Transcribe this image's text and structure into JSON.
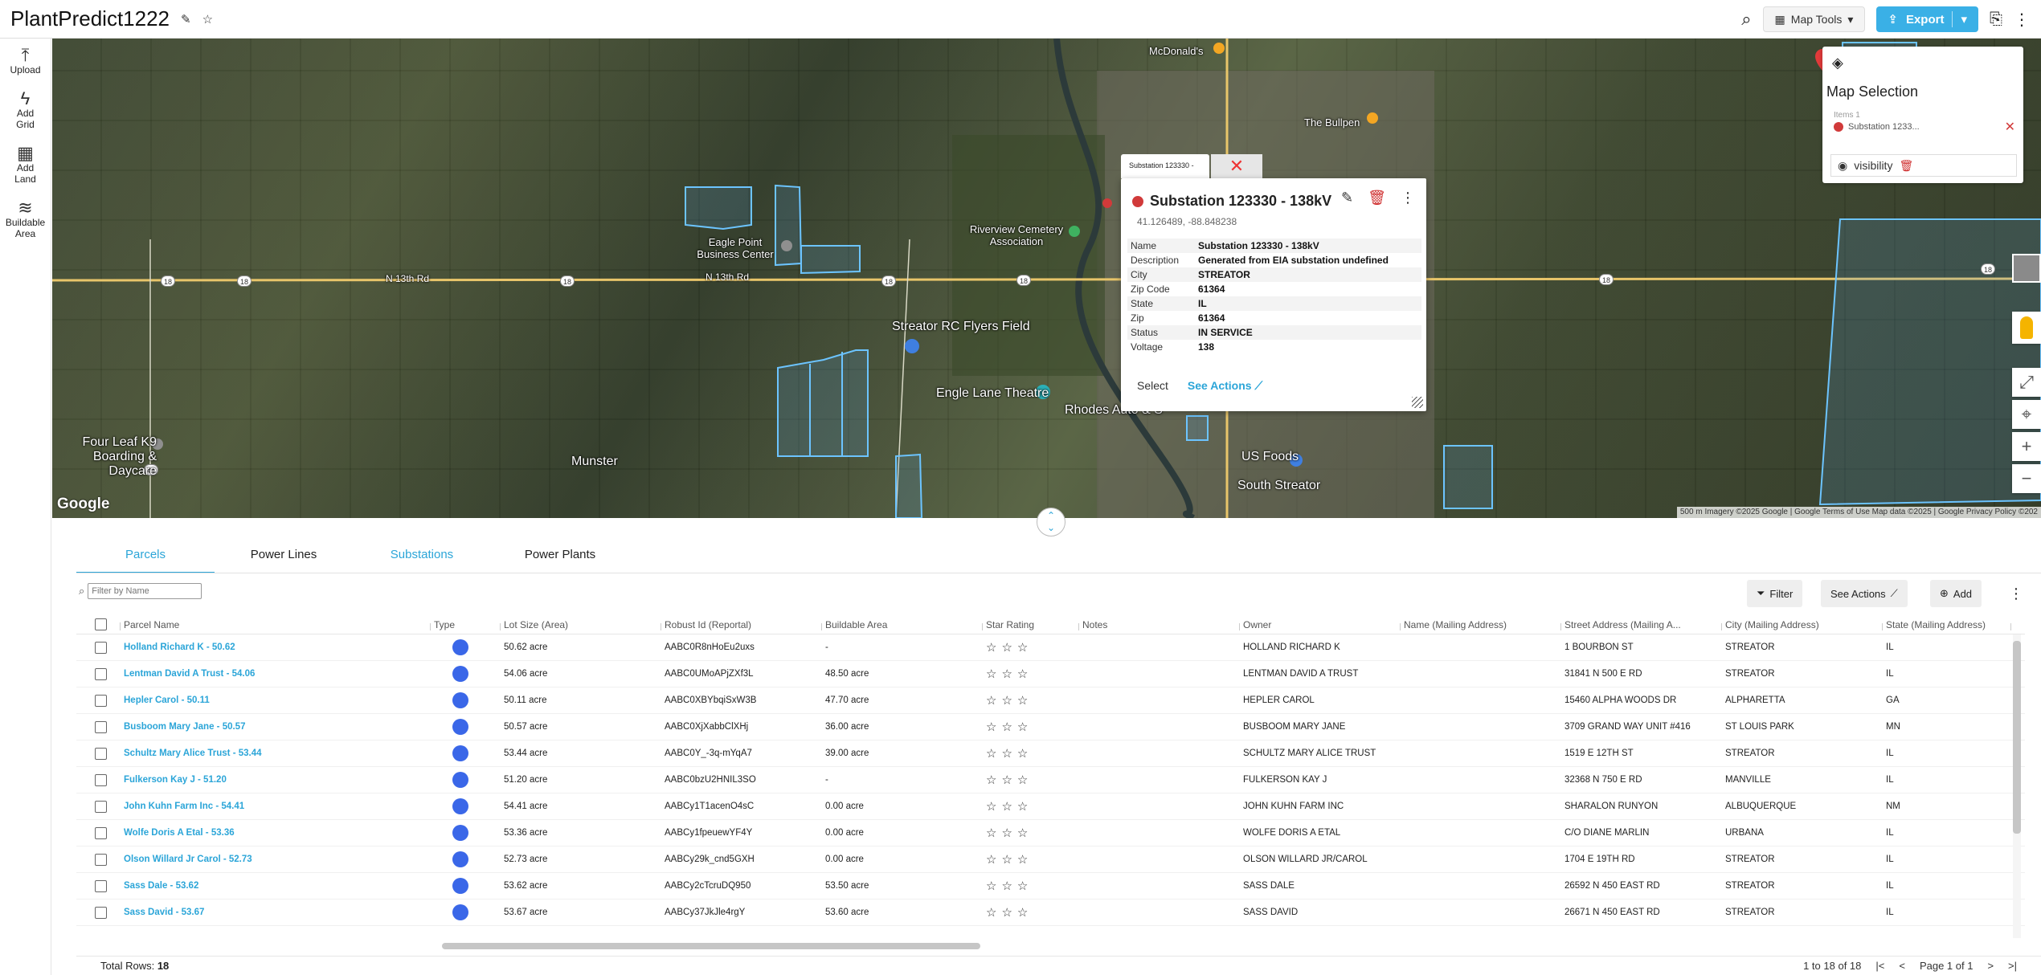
{
  "app": {
    "title": "PlantPredict1222"
  },
  "topbar": {
    "map_tools_label": "Map Tools",
    "export_label": "Export"
  },
  "left_rail": [
    {
      "label": "Upload",
      "icon": "upload-icon"
    },
    {
      "label": "Add Grid",
      "icon": "lightning-icon"
    },
    {
      "label": "Add Land",
      "icon": "grid-icon"
    },
    {
      "label": "Buildable Area",
      "icon": "layers-icon"
    }
  ],
  "map": {
    "labels": {
      "mcdonalds": "McDonald's",
      "bullpen": "The Bullpen",
      "riverview": "Riverview Cemetery Association",
      "eagle_point": "Eagle Point Business Center",
      "road1": "N 13th Rd",
      "road2": "N 13th Rd",
      "airfield": "Streator RC Flyers Field",
      "theatre": "Engle Lane Theatre",
      "rhodes": "Rhodes Auto & S",
      "four_leaf": "Four Leaf K9 Boarding & Daycare",
      "munster": "Munster",
      "us_foods": "US Foods",
      "south_streator": "South Streator"
    },
    "google": "Google",
    "attribution": "500 m   Imagery ©2025 Google | Google Terms of Use   Map data ©2025 | Google Privacy Policy ©202"
  },
  "popup": {
    "tab_label": "Substation 123330 -",
    "title": "Substation 123330 - 138kV",
    "coords": "41.126489, -88.848238",
    "rows": [
      {
        "k": "Name",
        "v": "Substation 123330 - 138kV"
      },
      {
        "k": "Description",
        "v": "Generated from EIA substation undefined"
      },
      {
        "k": "City",
        "v": "STREATOR"
      },
      {
        "k": "Zip Code",
        "v": "61364"
      },
      {
        "k": "State",
        "v": "IL"
      },
      {
        "k": "Zip",
        "v": "61364"
      },
      {
        "k": "Status",
        "v": "IN SERVICE"
      },
      {
        "k": "Voltage",
        "v": "138"
      }
    ],
    "select_label": "Select",
    "see_actions_label": "See Actions"
  },
  "map_selection": {
    "title": "Map Selection",
    "items_count": "Items 1",
    "item": "Substation 1233...",
    "visibility": "visibility"
  },
  "tabs": [
    {
      "label": "Parcels"
    },
    {
      "label": "Power Lines"
    },
    {
      "label": "Substations"
    },
    {
      "label": "Power Plants"
    }
  ],
  "toolbar": {
    "filter_placeholder": "Filter by Name",
    "filter_label": "Filter",
    "see_actions_label": "See Actions",
    "add_label": "Add"
  },
  "columns": [
    "Parcel Name",
    "Type",
    "Lot Size (Area)",
    "Robust Id (Reportal)",
    "Buildable Area",
    "Star Rating",
    "Notes",
    "Owner",
    "Name (Mailing Address)",
    "Street Address (Mailing A...",
    "City (Mailing Address)",
    "State (Mailing Address)"
  ],
  "rows": [
    {
      "name": "Holland Richard K - 50.62",
      "lot": "50.62 acre",
      "rid": "AABC0R8nHoEu2uxs",
      "ba": "-",
      "owner": "HOLLAND RICHARD K",
      "street": "1 BOURBON ST",
      "city": "STREATOR",
      "state": "IL"
    },
    {
      "name": "Lentman David A Trust - 54.06",
      "lot": "54.06 acre",
      "rid": "AABC0UMoAPjZXf3L",
      "ba": "48.50 acre",
      "owner": "LENTMAN DAVID A TRUST",
      "street": "31841 N 500 E RD",
      "city": "STREATOR",
      "state": "IL"
    },
    {
      "name": "Hepler Carol - 50.11",
      "lot": "50.11 acre",
      "rid": "AABC0XBYbqiSxW3B",
      "ba": "47.70 acre",
      "owner": "HEPLER CAROL",
      "street": "15460 ALPHA WOODS DR",
      "city": "ALPHARETTA",
      "state": "GA"
    },
    {
      "name": "Busboom Mary Jane - 50.57",
      "lot": "50.57 acre",
      "rid": "AABC0XjXabbClXHj",
      "ba": "36.00 acre",
      "owner": "BUSBOOM MARY JANE",
      "street": "3709 GRAND WAY UNIT #416",
      "city": "ST LOUIS PARK",
      "state": "MN"
    },
    {
      "name": "Schultz Mary Alice Trust - 53.44",
      "lot": "53.44 acre",
      "rid": "AABC0Y_-3q-mYqA7",
      "ba": "39.00 acre",
      "owner": "SCHULTZ MARY ALICE TRUST",
      "street": "1519 E 12TH ST",
      "city": "STREATOR",
      "state": "IL"
    },
    {
      "name": "Fulkerson Kay J - 51.20",
      "lot": "51.20 acre",
      "rid": "AABC0bzU2HNIL3SO",
      "ba": "-",
      "owner": "FULKERSON KAY J",
      "street": "32368 N 750 E RD",
      "city": "MANVILLE",
      "state": "IL"
    },
    {
      "name": "John Kuhn Farm Inc - 54.41",
      "lot": "54.41 acre",
      "rid": "AABCy1T1acenO4sC",
      "ba": "0.00 acre",
      "owner": "JOHN KUHN FARM INC",
      "street": "SHARALON RUNYON",
      "city": "ALBUQUERQUE",
      "state": "NM"
    },
    {
      "name": "Wolfe Doris A Etal - 53.36",
      "lot": "53.36 acre",
      "rid": "AABCy1fpeuewYF4Y",
      "ba": "0.00 acre",
      "owner": "WOLFE DORIS A ETAL",
      "street": "C/O DIANE MARLIN",
      "city": "URBANA",
      "state": "IL"
    },
    {
      "name": "Olson Willard Jr Carol - 52.73",
      "lot": "52.73 acre",
      "rid": "AABCy29k_cnd5GXH",
      "ba": "0.00 acre",
      "owner": "OLSON WILLARD JR/CAROL",
      "street": "1704 E 19TH RD",
      "city": "STREATOR",
      "state": "IL"
    },
    {
      "name": "Sass Dale - 53.62",
      "lot": "53.62 acre",
      "rid": "AABCy2cTcruDQ950",
      "ba": "53.50 acre",
      "owner": "SASS DALE",
      "street": "26592 N 450 EAST RD",
      "city": "STREATOR",
      "state": "IL"
    },
    {
      "name": "Sass David - 53.67",
      "lot": "53.67 acre",
      "rid": "AABCy37JkJle4rgY",
      "ba": "53.60 acre",
      "owner": "SASS DAVID",
      "street": "26671 N 450 EAST RD",
      "city": "STREATOR",
      "state": "IL"
    }
  ],
  "footer": {
    "total_label": "Total Rows:",
    "total": "18",
    "range": "1 to 18 of 18",
    "page_text": "Page 1 of 1"
  }
}
